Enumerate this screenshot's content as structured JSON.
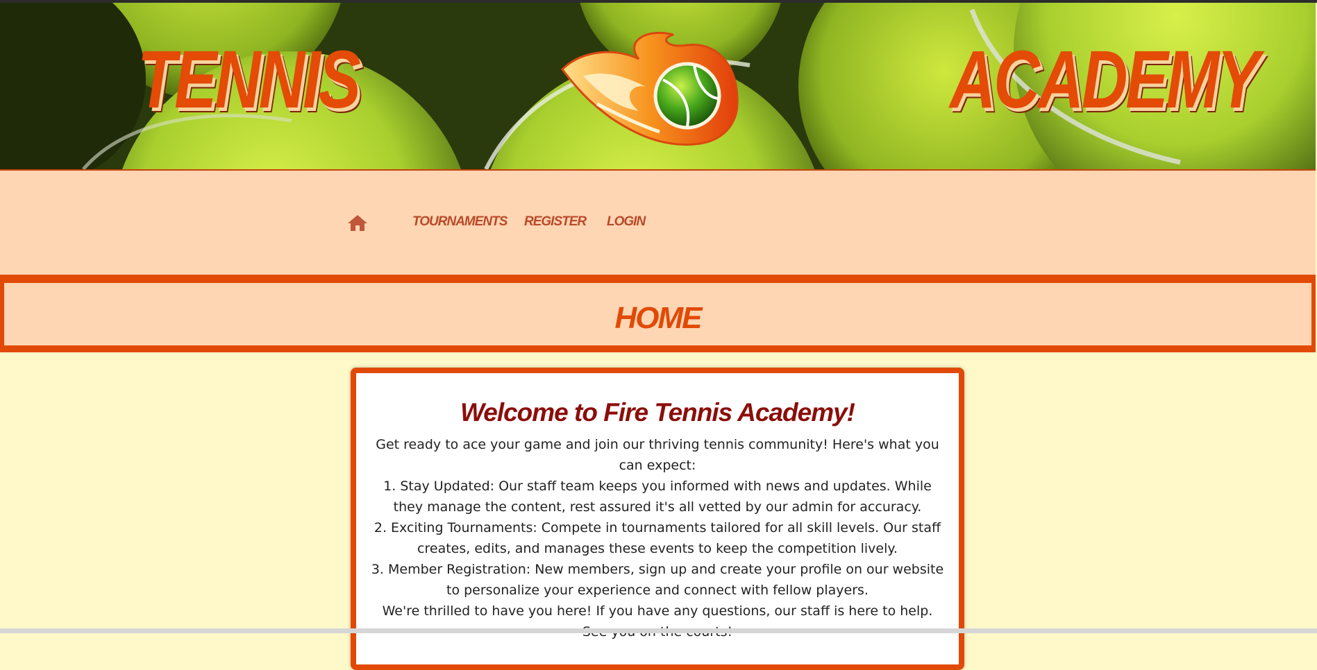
{
  "banner": {
    "left_word": "TENNIS",
    "right_word": "ACADEMY",
    "logo_icon": "flaming-tennis-ball-icon"
  },
  "nav": {
    "home_icon": "home-icon",
    "items": [
      {
        "label": "TOURNAMENTS"
      },
      {
        "label": "REGISTER"
      },
      {
        "label": "LOGIN"
      }
    ]
  },
  "page": {
    "title": "HOME"
  },
  "welcome": {
    "heading": "Welcome to Fire Tennis Academy!",
    "intro": "Get ready to ace your game and join our thriving tennis community! Here's what you can expect:",
    "points": [
      "1. Stay Updated: Our staff team keeps you informed with news and updates. While they manage the content, rest assured it's all vetted by our admin for accuracy.",
      "2. Exciting Tournaments: Compete in tournaments tailored for all skill levels. Our staff creates, edits, and manages these events to keep the competition lively.",
      "3. Member Registration: New members, sign up and create your profile on our website to personalize your experience and connect with fellow players."
    ],
    "closing": "We're thrilled to have you here! If you have any questions, our staff is here to help. See you on the courts!"
  },
  "colors": {
    "accent": "#e04a06",
    "nav_bg": "#ffd6b3",
    "page_bg": "#fff9c9",
    "heading": "#8b0e0a",
    "nav_text": "#b84a2a"
  }
}
